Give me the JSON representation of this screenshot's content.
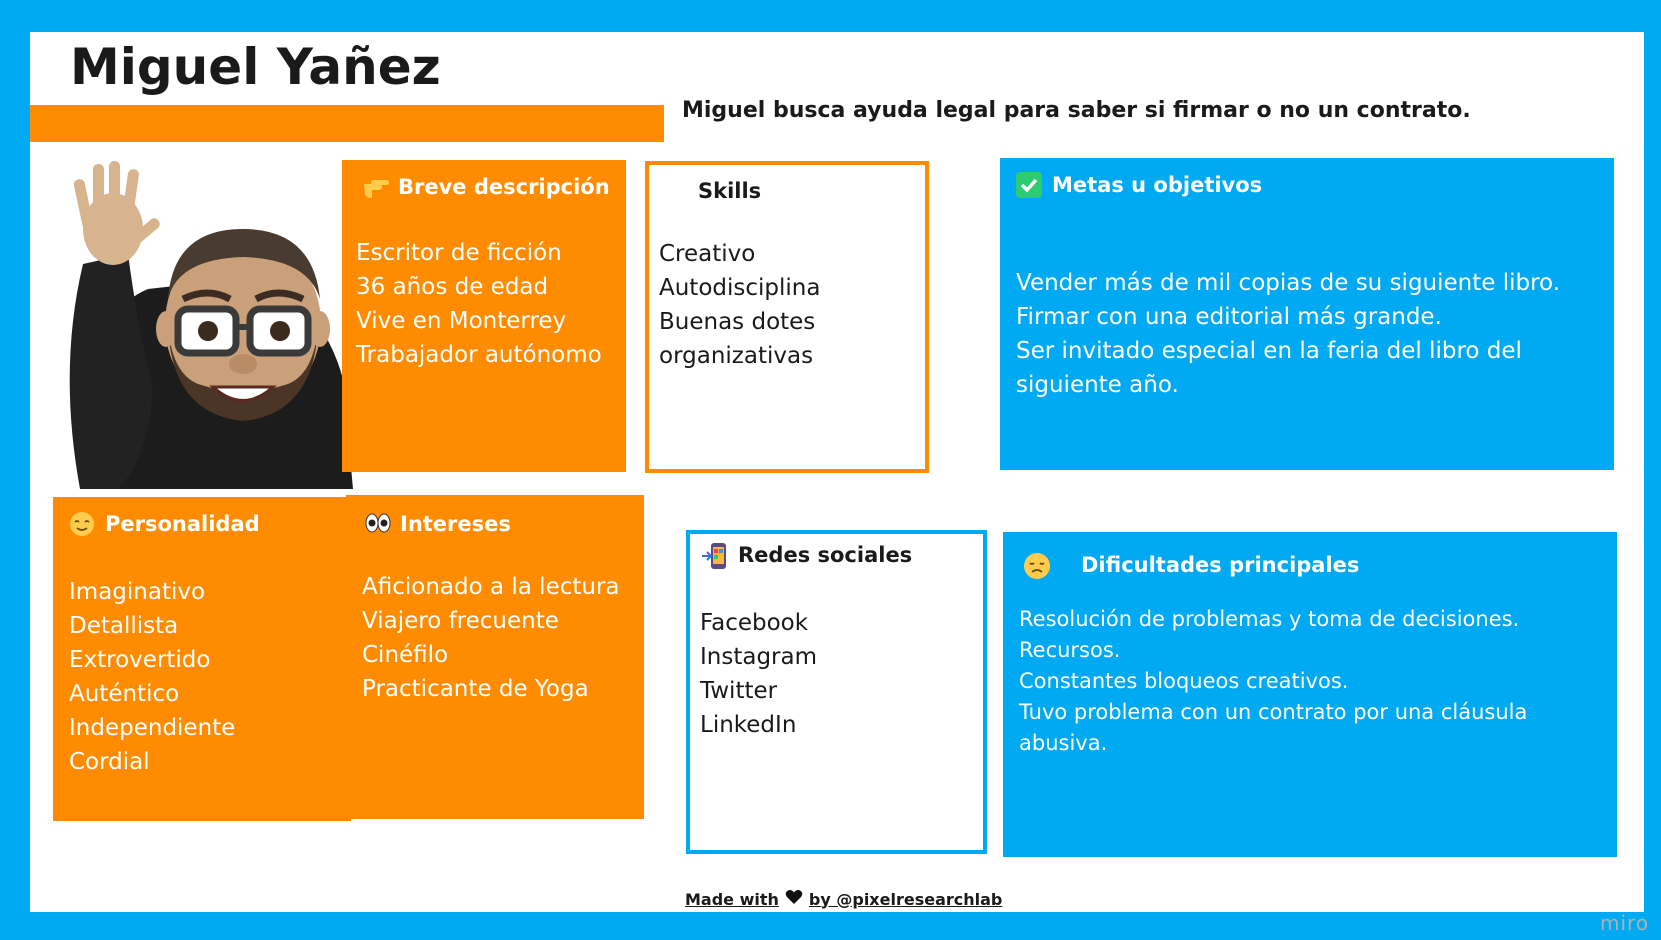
{
  "header": {
    "name": "Miguel Yañez",
    "summary": "Miguel busca ayuda legal para saber si firmar o no un contrato."
  },
  "avatar": {
    "icon": "memoji-waving-man-icon"
  },
  "cards": {
    "descripcion": {
      "icon": "pointing-hand-icon",
      "title": "Breve descripción",
      "items": [
        "Escritor de ficción",
        "36 años de edad",
        "Vive en Monterrey",
        "Trabajador autónomo"
      ]
    },
    "skills": {
      "title": "Skills",
      "items": [
        "Creativo",
        "Autodisciplina",
        "Buenas dotes",
        "organizativas"
      ]
    },
    "metas": {
      "icon": "check-mark-icon",
      "title": "Metas u objetivos",
      "lines": [
        "Vender más de mil copias de su siguiente libro.",
        "Firmar con una editorial más grande.",
        "Ser invitado especial en la feria del libro del",
        "siguiente año."
      ]
    },
    "personalidad": {
      "icon": "relieved-face-icon",
      "title": "Personalidad",
      "items": [
        "Imaginativo",
        "Detallista",
        "Extrovertido",
        "Auténtico",
        "Independiente",
        "Cordial"
      ]
    },
    "intereses": {
      "icon": "eyes-icon",
      "title": "Intereses",
      "items": [
        "Aficionado a la lectura",
        "Viajero frecuente",
        "Cinéfilo",
        "Practicante de Yoga"
      ]
    },
    "redes": {
      "icon": "mobile-phone-arrow-icon",
      "title": "Redes sociales",
      "items": [
        "Facebook",
        "Instagram",
        "Twitter",
        "LinkedIn"
      ]
    },
    "dificultades": {
      "icon": "disappointed-face-icon",
      "title": "Dificultades principales",
      "lines": [
        "Resolución de problemas y toma de decisiones.",
        "Recursos.",
        "Constantes bloqueos creativos.",
        "Tuvo problema con un contrato por una cláusula",
        "abusiva."
      ]
    }
  },
  "footer": {
    "made_with": "Made with",
    "heart_icon": "heart-icon",
    "by": "by @pixelresearchlab",
    "brand": "miro"
  },
  "colors": {
    "orange": "#ff8c00",
    "blue": "#00aaf2",
    "text": "#1a1a1a"
  }
}
